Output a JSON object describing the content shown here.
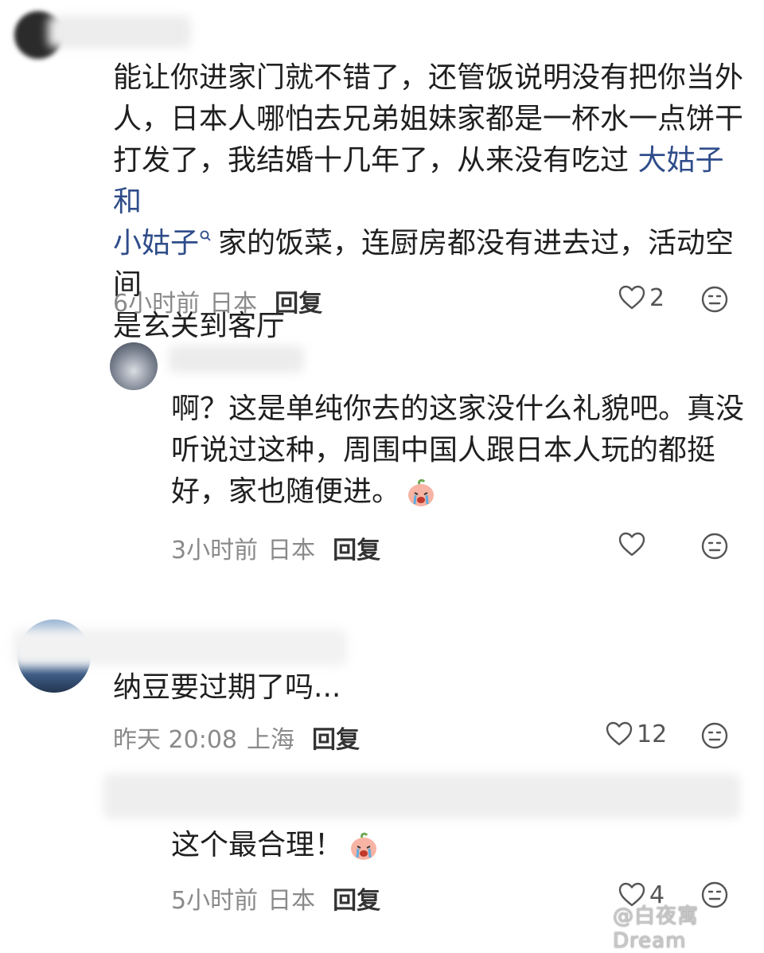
{
  "comments": [
    {
      "text_lines": [
        "能让你进家门就不错了，还管饭说明没有把你当外",
        "人，日本人哪怕去兄弟姐妹家都是一杯水一点饼干",
        "打发了，我结婚十几年了，从来没有吃过"
      ],
      "link_a": "大姑子和",
      "link_b": "小姑子",
      "link_b_icon": "search-icon",
      "cont_a": "家的饭菜，连厨房都没有进去过，活动空间",
      "cont_b": "是玄关到客厅",
      "time": "6小时前",
      "location": "日本",
      "reply_label": "回复",
      "likes": "2"
    },
    {
      "text_lines": [
        "啊？这是单纯你去的这家没什么礼貌吧。真没",
        "听说过这种，周围中国人跟日本人玩的都挺",
        "好，家也随便进。"
      ],
      "emoji": "crying-peach-emoji",
      "time": "3小时前",
      "location": "日本",
      "reply_label": "回复",
      "likes": ""
    },
    {
      "text": "纳豆要过期了吗...",
      "time": "昨天 20:08",
      "location": "上海",
      "reply_label": "回复",
      "likes": "12"
    },
    {
      "text": "这个最合理！",
      "emoji": "crying-peach-emoji",
      "time": "5小时前",
      "location": "日本",
      "reply_label": "回复",
      "likes": "4"
    }
  ],
  "icons": {
    "like": "heart-outline-icon",
    "dislike": "meh-face-icon"
  },
  "watermark": "@白夜寓Dream",
  "colors": {
    "link": "#2f4d8a",
    "meta": "#8a8a8a"
  }
}
